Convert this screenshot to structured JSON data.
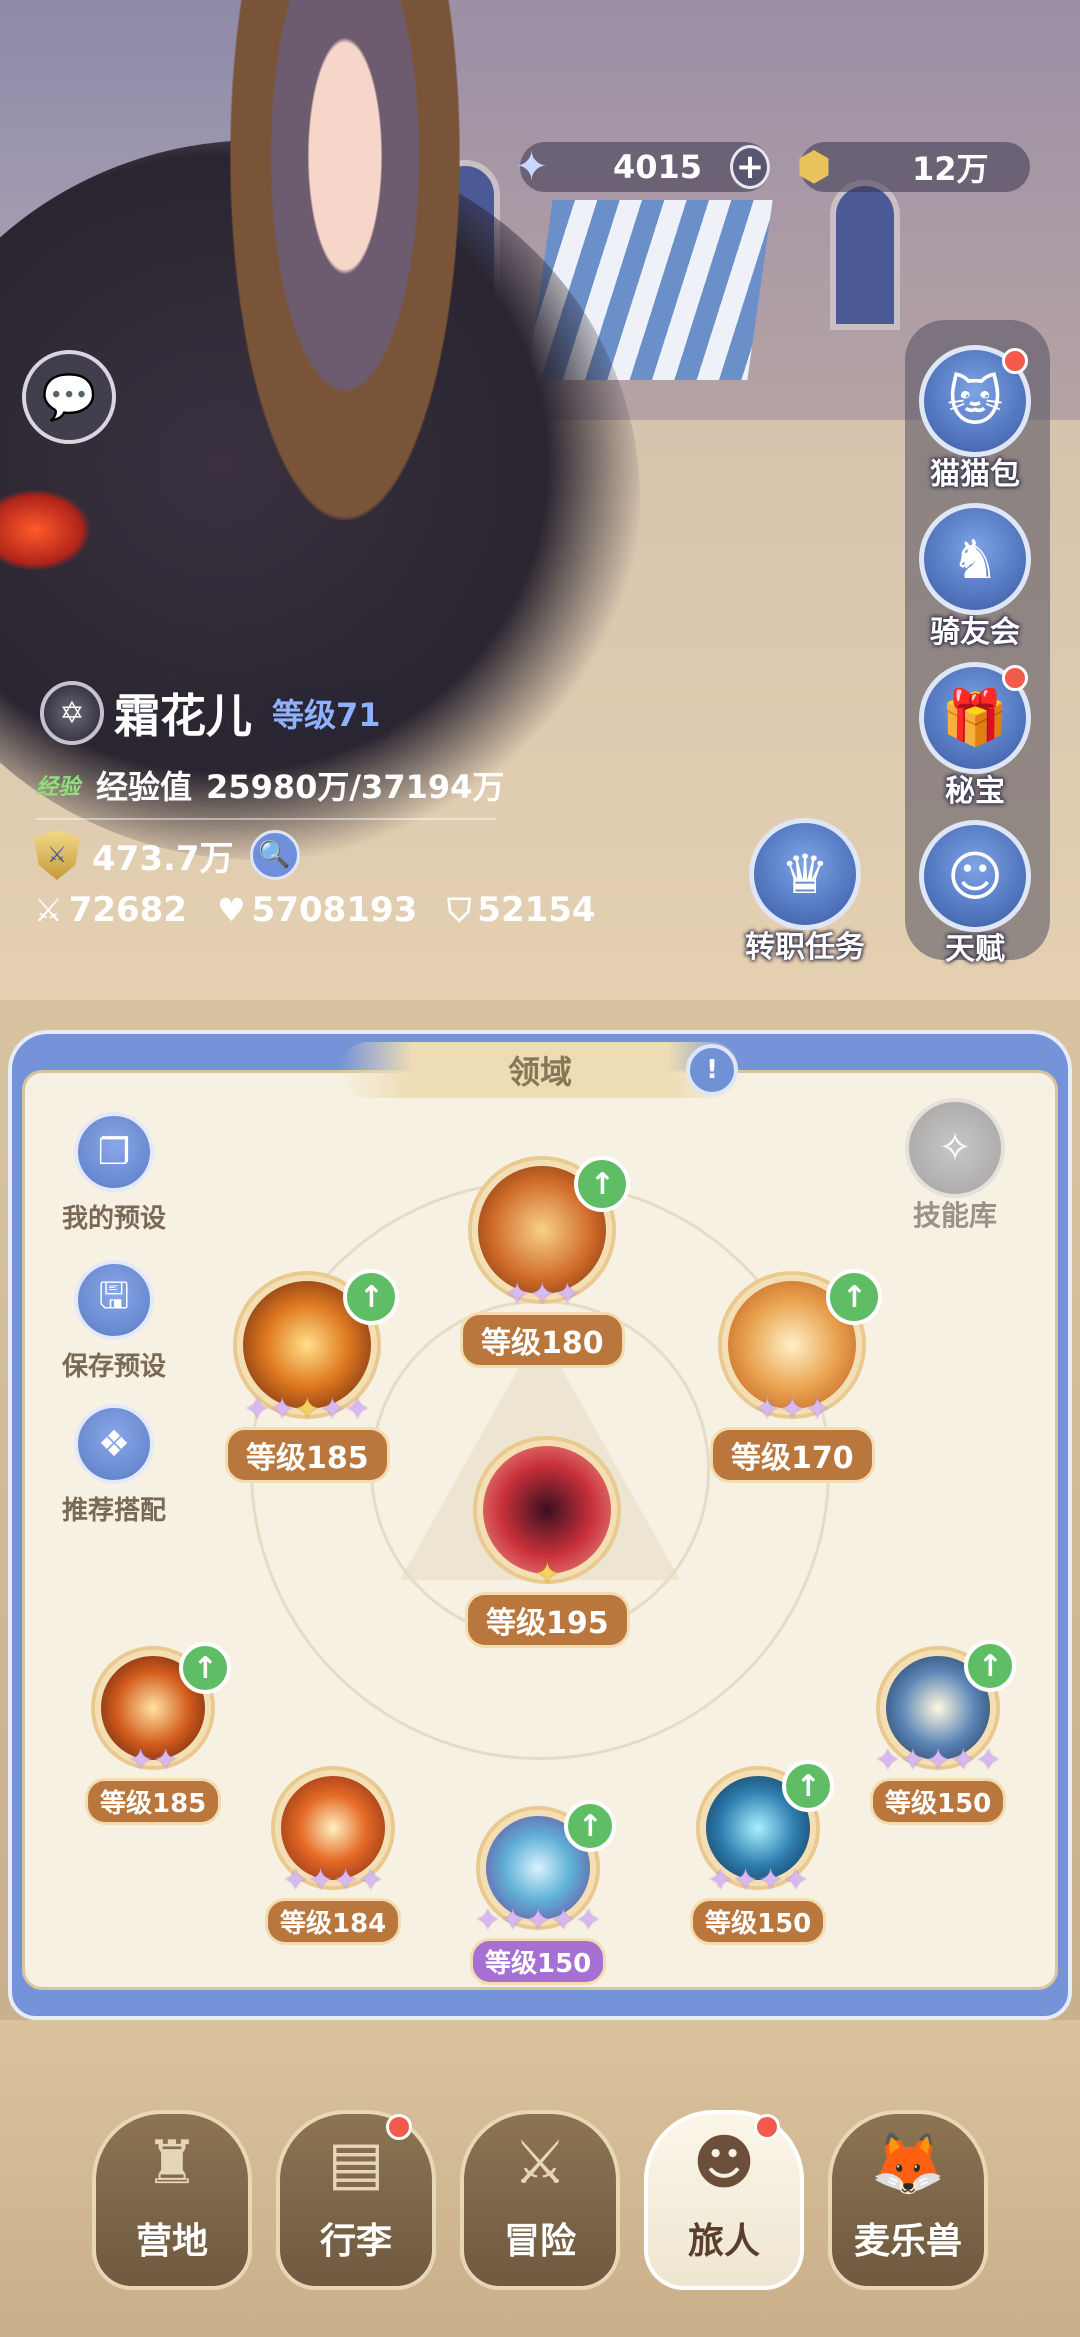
{
  "currency": {
    "stars_value": "4015",
    "gold_value": "12万",
    "plus_label": "+"
  },
  "side_menu": {
    "cat_bag": "猫猫包",
    "rider_club": "骑友会",
    "treasure": "秘宝",
    "job_task": "转职任务",
    "talent": "天赋"
  },
  "player": {
    "name": "霜花儿",
    "level_label": "等级71",
    "exp_tag": "经验",
    "exp_label": "经验值",
    "exp_value": "25980万/37194万",
    "power": "473.7万",
    "attack": "72682",
    "hp": "5708193",
    "defense": "52154"
  },
  "panel": {
    "title": "领域",
    "my_presets": "我的预设",
    "save_preset": "保存预设",
    "recommend": "推荐搭配",
    "skill_library": "技能库"
  },
  "skills": {
    "top": "等级180",
    "left": "等级185",
    "right": "等级170",
    "center": "等级195",
    "bottom_left_1": "等级185",
    "bottom_left_2": "等级184",
    "bottom_center": "等级150",
    "bottom_right_2": "等级150",
    "bottom_right_1": "等级150"
  },
  "nav": {
    "camp": "营地",
    "luggage": "行李",
    "adventure": "冒险",
    "traveler": "旅人",
    "pets": "麦乐兽"
  },
  "colors": {
    "panel_blue": "#7593d8",
    "level_brown": "#b9773e",
    "level_purple": "#a56fd3",
    "upgrade_green": "#5fbe65",
    "notify_red": "#f25a4c"
  }
}
